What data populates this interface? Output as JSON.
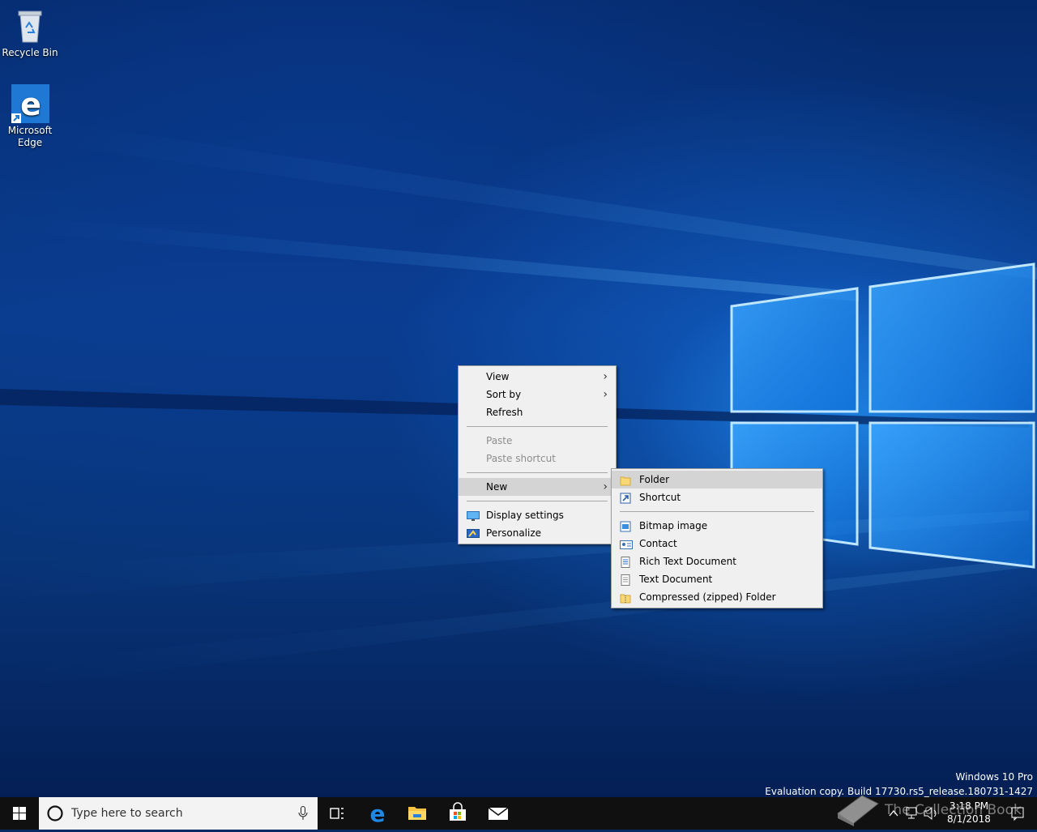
{
  "desktop": {
    "icons": [
      {
        "label": "Recycle Bin",
        "icon": "recycle-bin-icon"
      },
      {
        "label_line1": "Microsoft",
        "label_line2": "Edge",
        "icon": "edge-icon"
      }
    ]
  },
  "context_menu": {
    "items": [
      {
        "label": "View",
        "submenu": true,
        "enabled": true
      },
      {
        "label": "Sort by",
        "submenu": true,
        "enabled": true
      },
      {
        "label": "Refresh",
        "enabled": true
      },
      {
        "label": "Paste",
        "enabled": false
      },
      {
        "label": "Paste shortcut",
        "enabled": false
      },
      {
        "label": "New",
        "submenu": true,
        "enabled": true,
        "highlighted": true
      },
      {
        "label": "Display settings",
        "icon": "display-settings-icon",
        "enabled": true
      },
      {
        "label": "Personalize",
        "icon": "personalize-icon",
        "enabled": true
      }
    ]
  },
  "new_submenu": {
    "items": [
      {
        "label": "Folder",
        "icon": "folder-icon",
        "highlighted": true
      },
      {
        "label": "Shortcut",
        "icon": "shortcut-icon"
      },
      {
        "label": "Bitmap image",
        "icon": "bitmap-icon"
      },
      {
        "label": "Contact",
        "icon": "contact-icon"
      },
      {
        "label": "Rich Text Document",
        "icon": "rich-text-icon"
      },
      {
        "label": "Text Document",
        "icon": "text-document-icon"
      },
      {
        "label": "Compressed (zipped) Folder",
        "icon": "zip-folder-icon"
      }
    ]
  },
  "watermark": {
    "edition": "Windows 10 Pro",
    "build": "Evaluation copy. Build 17730.rs5_release.180731-1427"
  },
  "taskbar": {
    "search_placeholder": "Type here to search",
    "apps": [
      "task-view-icon",
      "edge-icon",
      "file-explorer-icon",
      "store-icon",
      "mail-icon"
    ],
    "time": "3:18 PM",
    "date": "8/1/2018",
    "overlay_text": "The Collection Book"
  }
}
